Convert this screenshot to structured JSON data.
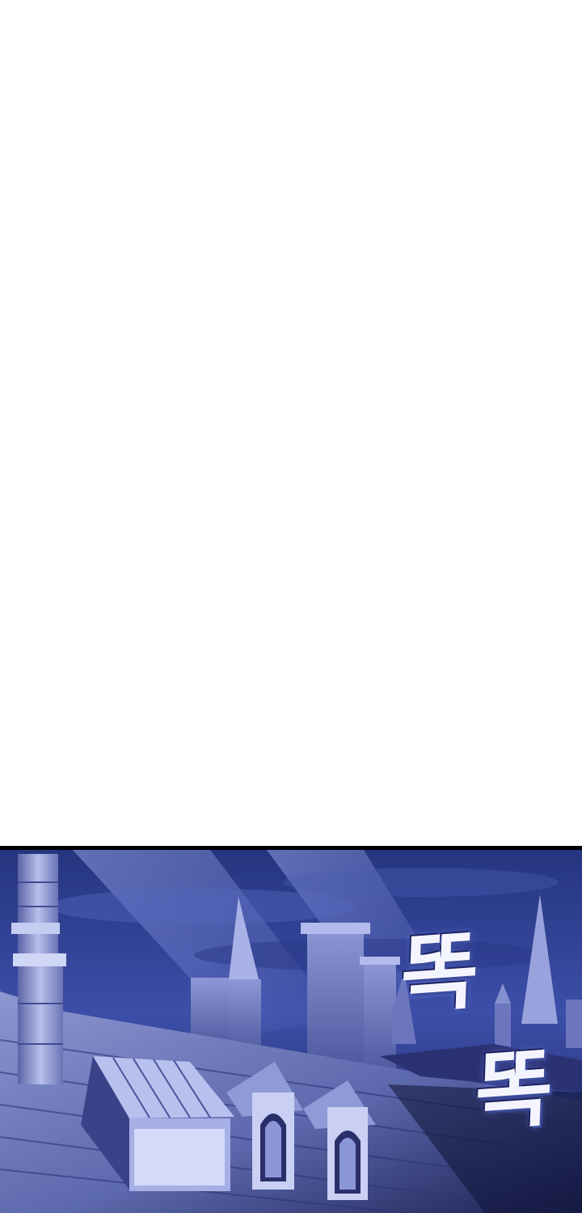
{
  "page": {
    "background": "#ffffff"
  },
  "panel": {
    "sky_color": "#3c4ea8",
    "building_color": "#7f8bc9",
    "sfx": {
      "first": "똑",
      "second": "똑"
    }
  }
}
